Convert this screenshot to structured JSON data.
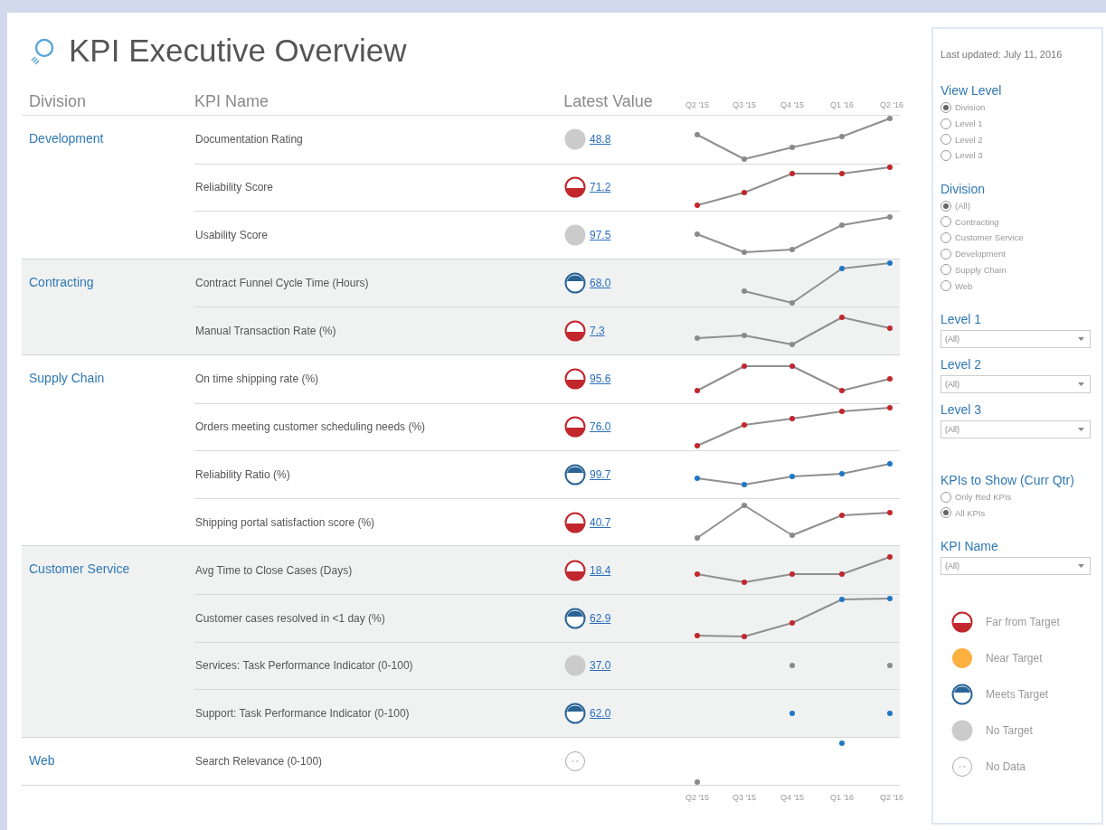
{
  "title": "KPI Executive Overview",
  "columns": [
    "Division",
    "KPI Name",
    "Latest Value"
  ],
  "quarters_top": [
    "Q2 '15",
    "Q3 '15",
    "Q4 '15",
    "Q1 '16",
    "Q2 '16"
  ],
  "groups": [
    {
      "division": "Development",
      "shaded": false,
      "kpis": [
        {
          "name": "Documentation Rating",
          "kind": "none",
          "value": "48.8",
          "trend": [
            {
              "shown": true,
              "color": "#8a8a8a"
            },
            {
              "shown": true,
              "color": "#8a8a8a"
            },
            {
              "shown": true,
              "color": "#8a8a8a"
            },
            {
              "shown": true,
              "color": "#8a8a8a"
            },
            {
              "shown": true,
              "color": "#8a8a8a"
            }
          ]
        },
        {
          "name": "Reliability Score",
          "kind": "far",
          "value": "71.2",
          "trend": [
            {
              "shown": true,
              "color": "#c1272d"
            },
            {
              "shown": true,
              "color": "#c1272d"
            },
            {
              "shown": true,
              "color": "#c1272d"
            },
            {
              "shown": true,
              "color": "#c1272d"
            },
            {
              "shown": true,
              "color": "#c1272d"
            }
          ]
        },
        {
          "name": "Usability Score",
          "kind": "none",
          "value": "97.5",
          "trend": [
            {
              "shown": true,
              "color": "#8a8a8a"
            },
            {
              "shown": true,
              "color": "#8a8a8a"
            },
            {
              "shown": true,
              "color": "#8a8a8a"
            },
            {
              "shown": true,
              "color": "#8a8a8a"
            },
            {
              "shown": true,
              "color": "#8a8a8a"
            }
          ]
        }
      ]
    },
    {
      "division": "Contracting",
      "shaded": true,
      "kpis": [
        {
          "name": "Contract Funnel Cycle Time (Hours)",
          "kind": "meets",
          "value": "68.0",
          "trend": [
            {
              "shown": false
            },
            {
              "shown": true,
              "color": "#8a8a8a"
            },
            {
              "shown": true,
              "color": "#8a8a8a"
            },
            {
              "shown": true,
              "color": "#1f77c4"
            },
            {
              "shown": true,
              "color": "#1f77c4"
            }
          ]
        },
        {
          "name": "Manual Transaction Rate (%)",
          "kind": "far",
          "value": "7.3",
          "trend": [
            {
              "shown": true,
              "color": "#8a8a8a"
            },
            {
              "shown": true,
              "color": "#8a8a8a"
            },
            {
              "shown": true,
              "color": "#8a8a8a"
            },
            {
              "shown": true,
              "color": "#c1272d"
            },
            {
              "shown": true,
              "color": "#c1272d"
            }
          ]
        }
      ]
    },
    {
      "division": "Supply Chain",
      "shaded": false,
      "kpis": [
        {
          "name": "On time shipping rate (%)",
          "kind": "far",
          "value": "95.6",
          "trend": [
            {
              "shown": true,
              "color": "#c1272d"
            },
            {
              "shown": true,
              "color": "#c1272d"
            },
            {
              "shown": true,
              "color": "#c1272d"
            },
            {
              "shown": true,
              "color": "#c1272d"
            },
            {
              "shown": true,
              "color": "#c1272d"
            }
          ]
        },
        {
          "name": "Orders meeting customer scheduling needs (%)",
          "kind": "far",
          "value": "76.0",
          "trend": [
            {
              "shown": true,
              "color": "#c1272d"
            },
            {
              "shown": true,
              "color": "#c1272d"
            },
            {
              "shown": true,
              "color": "#c1272d"
            },
            {
              "shown": true,
              "color": "#c1272d"
            },
            {
              "shown": true,
              "color": "#c1272d"
            }
          ]
        },
        {
          "name": "Reliability Ratio (%)",
          "kind": "meets",
          "value": "99.7",
          "trend": [
            {
              "shown": true,
              "color": "#1f77c4"
            },
            {
              "shown": true,
              "color": "#1f77c4"
            },
            {
              "shown": true,
              "color": "#1f77c4"
            },
            {
              "shown": true,
              "color": "#1f77c4"
            },
            {
              "shown": true,
              "color": "#1f77c4"
            }
          ]
        },
        {
          "name": "Shipping portal satisfaction score (%)",
          "kind": "far",
          "value": "40.7",
          "trend": [
            {
              "shown": true,
              "color": "#8a8a8a"
            },
            {
              "shown": true,
              "color": "#8a8a8a"
            },
            {
              "shown": true,
              "color": "#8a8a8a"
            },
            {
              "shown": true,
              "color": "#c1272d"
            },
            {
              "shown": true,
              "color": "#c1272d"
            }
          ]
        }
      ]
    },
    {
      "division": "Customer Service",
      "shaded": true,
      "kpis": [
        {
          "name": "Avg Time to Close Cases (Days)",
          "kind": "far",
          "value": "18.4",
          "trend": [
            {
              "shown": true,
              "color": "#c1272d"
            },
            {
              "shown": true,
              "color": "#c1272d"
            },
            {
              "shown": true,
              "color": "#c1272d"
            },
            {
              "shown": true,
              "color": "#c1272d"
            },
            {
              "shown": true,
              "color": "#c1272d"
            }
          ]
        },
        {
          "name": "Customer cases resolved in <1 day (%)",
          "kind": "meets",
          "value": "62.9",
          "trend": [
            {
              "shown": true,
              "color": "#c1272d"
            },
            {
              "shown": true,
              "color": "#c1272d"
            },
            {
              "shown": true,
              "color": "#c1272d"
            },
            {
              "shown": true,
              "color": "#1f77c4"
            },
            {
              "shown": true,
              "color": "#1f77c4"
            }
          ]
        },
        {
          "name": "Services: Task Performance Indicator (0-100)",
          "kind": "none",
          "value": "37.0",
          "trend": [
            {
              "shown": false
            },
            {
              "shown": false
            },
            {
              "shown": true,
              "color": "#8a8a8a"
            },
            {
              "shown": false
            },
            {
              "shown": true,
              "color": "#8a8a8a"
            }
          ]
        },
        {
          "name": "Support: Task Performance Indicator (0-100)",
          "kind": "meets",
          "value": "62.0",
          "trend": [
            {
              "shown": false
            },
            {
              "shown": false
            },
            {
              "shown": true,
              "color": "#1f77c4"
            },
            {
              "shown": false
            },
            {
              "shown": true,
              "color": "#1f77c4"
            }
          ]
        }
      ]
    },
    {
      "division": "Web",
      "shaded": false,
      "kpis": [
        {
          "name": "Search Relevance (0-100)",
          "kind": "nodata",
          "trend": [
            {
              "shown": true,
              "color": "#8a8a8a"
            },
            {
              "shown": false
            },
            {
              "shown": false
            },
            {
              "shown": true,
              "color": "#1f77c4"
            },
            {
              "shown": false
            }
          ]
        }
      ]
    }
  ],
  "quarters_bottom": [
    "Q2 '15",
    "Q3 '15",
    "Q4 '15",
    "Q1 '16",
    "Q2 '16"
  ],
  "sidebar": {
    "last_updated": "Last updated: July 11, 2016",
    "filters": [
      {
        "kind": "radio",
        "title": "View Level",
        "options": [
          {
            "label": "Division",
            "selected": true
          },
          {
            "label": "Level 1",
            "selected": false
          },
          {
            "label": "Level 2",
            "selected": false
          },
          {
            "label": "Level 3",
            "selected": false
          }
        ]
      },
      {
        "kind": "radio",
        "title": "Division",
        "options": [
          {
            "label": "(All)",
            "selected": true
          },
          {
            "label": "Contracting",
            "selected": false
          },
          {
            "label": "Customer Service",
            "selected": false
          },
          {
            "label": "Development",
            "selected": false
          },
          {
            "label": "Supply Chain",
            "selected": false
          },
          {
            "label": "Web",
            "selected": false
          }
        ]
      },
      {
        "kind": "dropdown",
        "title": "Level 1",
        "value": "(All)"
      },
      {
        "kind": "dropdown",
        "title": "Level 2",
        "value": "(All)"
      },
      {
        "kind": "dropdown",
        "title": "Level 3",
        "value": "(All)"
      },
      {
        "kind": "radio",
        "title": "KPIs to Show (Curr Qtr)",
        "options": [
          {
            "label": "Only Red KPIs",
            "selected": false
          },
          {
            "label": "All KPIs",
            "selected": true
          }
        ]
      },
      {
        "kind": "dropdown",
        "title": "KPI Name",
        "value": "(All)"
      }
    ],
    "legend": [
      {
        "kind": "far",
        "label": "Far from Target"
      },
      {
        "kind": "near",
        "label": "Near Target"
      },
      {
        "kind": "meets",
        "label": "Meets Target"
      },
      {
        "kind": "none",
        "label": "No Target"
      },
      {
        "kind": "nodata",
        "label": "No Data"
      }
    ]
  }
}
